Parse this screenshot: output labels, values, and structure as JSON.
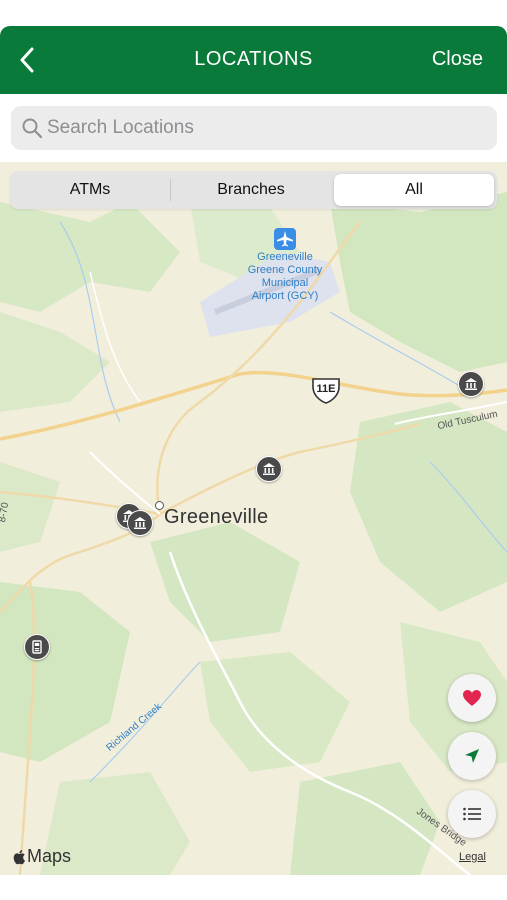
{
  "header": {
    "title": "LOCATIONS",
    "close_label": "Close",
    "color": "#0a7a3a"
  },
  "search": {
    "placeholder": "Search Locations",
    "value": ""
  },
  "segments": [
    {
      "label": "ATMs",
      "selected": false
    },
    {
      "label": "Branches",
      "selected": false
    },
    {
      "label": "All",
      "selected": true
    }
  ],
  "map": {
    "airport_label": "Greeneville\nGreene County\nMunicipal\nAirport (GCY)",
    "city_label": "Greeneville",
    "route_shield": "11E",
    "road_labels": [
      "Old Tusculum",
      "Richland Creek",
      "Jones Bridge",
      "8-70"
    ],
    "attribution": "Maps",
    "legal_label": "Legal",
    "pins": [
      {
        "type": "bank-icon"
      },
      {
        "type": "bank-icon"
      },
      {
        "type": "bank-icon"
      },
      {
        "type": "bank-icon"
      },
      {
        "type": "atm-icon"
      }
    ]
  },
  "map_controls": [
    "heart-icon",
    "location-arrow-icon",
    "list-icon"
  ]
}
